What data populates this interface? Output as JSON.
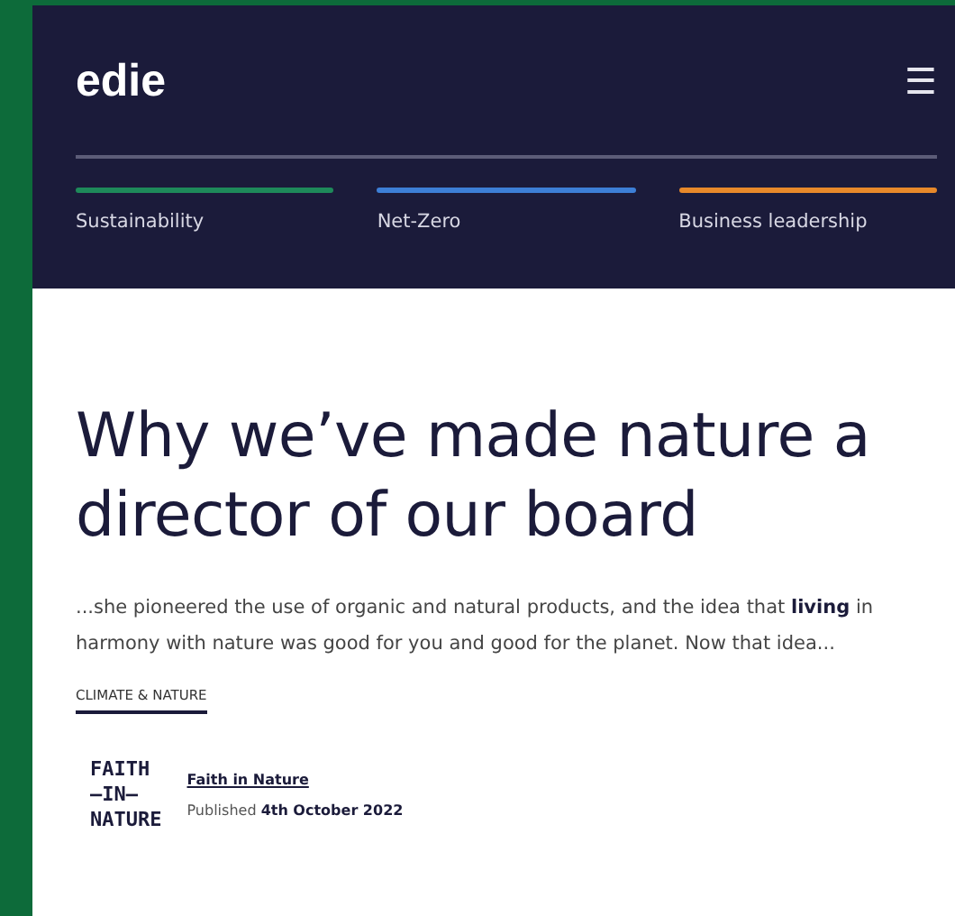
{
  "header": {
    "logo": "edie",
    "menu_icon": "☰"
  },
  "nav": [
    {
      "label": "Sustainability",
      "color": "#1e8a5a"
    },
    {
      "label": "Net-Zero",
      "color": "#3d7fd6"
    },
    {
      "label": "Business leadership",
      "color": "#e8892a"
    }
  ],
  "article": {
    "title": "Why we’ve made nature a director of our board",
    "excerpt": "...she pioneered the use of organic and natural products, and the idea that **living** in harmony with nature was good for you and good for the planet. Now that idea...",
    "tag": "CLIMATE & NATURE",
    "author": {
      "logo_lines": [
        "FAITH",
        "—IN—",
        "NATURE"
      ],
      "name": "Faith in Nature",
      "published": "Published **4th October 2022**"
    }
  }
}
